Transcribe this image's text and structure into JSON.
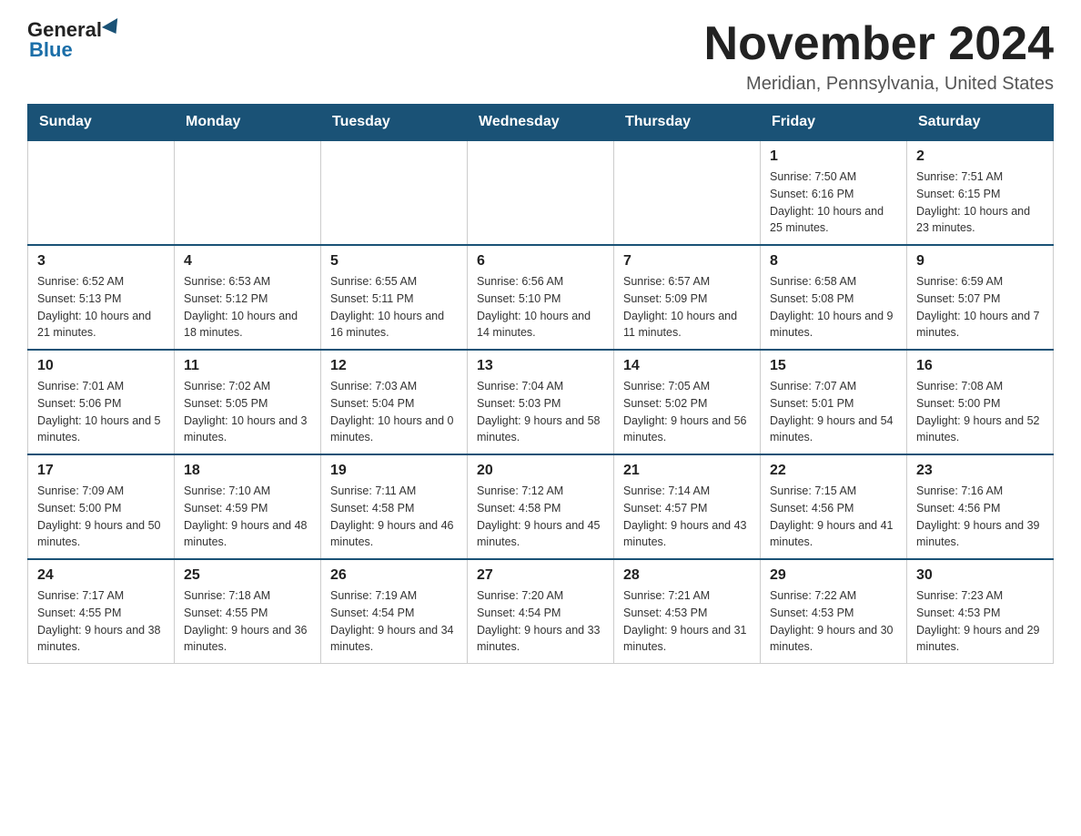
{
  "header": {
    "logo_general": "General",
    "logo_blue": "Blue",
    "month_title": "November 2024",
    "location": "Meridian, Pennsylvania, United States"
  },
  "days_of_week": [
    "Sunday",
    "Monday",
    "Tuesday",
    "Wednesday",
    "Thursday",
    "Friday",
    "Saturday"
  ],
  "weeks": [
    [
      {
        "day": "",
        "info": ""
      },
      {
        "day": "",
        "info": ""
      },
      {
        "day": "",
        "info": ""
      },
      {
        "day": "",
        "info": ""
      },
      {
        "day": "",
        "info": ""
      },
      {
        "day": "1",
        "info": "Sunrise: 7:50 AM\nSunset: 6:16 PM\nDaylight: 10 hours and 25 minutes."
      },
      {
        "day": "2",
        "info": "Sunrise: 7:51 AM\nSunset: 6:15 PM\nDaylight: 10 hours and 23 minutes."
      }
    ],
    [
      {
        "day": "3",
        "info": "Sunrise: 6:52 AM\nSunset: 5:13 PM\nDaylight: 10 hours and 21 minutes."
      },
      {
        "day": "4",
        "info": "Sunrise: 6:53 AM\nSunset: 5:12 PM\nDaylight: 10 hours and 18 minutes."
      },
      {
        "day": "5",
        "info": "Sunrise: 6:55 AM\nSunset: 5:11 PM\nDaylight: 10 hours and 16 minutes."
      },
      {
        "day": "6",
        "info": "Sunrise: 6:56 AM\nSunset: 5:10 PM\nDaylight: 10 hours and 14 minutes."
      },
      {
        "day": "7",
        "info": "Sunrise: 6:57 AM\nSunset: 5:09 PM\nDaylight: 10 hours and 11 minutes."
      },
      {
        "day": "8",
        "info": "Sunrise: 6:58 AM\nSunset: 5:08 PM\nDaylight: 10 hours and 9 minutes."
      },
      {
        "day": "9",
        "info": "Sunrise: 6:59 AM\nSunset: 5:07 PM\nDaylight: 10 hours and 7 minutes."
      }
    ],
    [
      {
        "day": "10",
        "info": "Sunrise: 7:01 AM\nSunset: 5:06 PM\nDaylight: 10 hours and 5 minutes."
      },
      {
        "day": "11",
        "info": "Sunrise: 7:02 AM\nSunset: 5:05 PM\nDaylight: 10 hours and 3 minutes."
      },
      {
        "day": "12",
        "info": "Sunrise: 7:03 AM\nSunset: 5:04 PM\nDaylight: 10 hours and 0 minutes."
      },
      {
        "day": "13",
        "info": "Sunrise: 7:04 AM\nSunset: 5:03 PM\nDaylight: 9 hours and 58 minutes."
      },
      {
        "day": "14",
        "info": "Sunrise: 7:05 AM\nSunset: 5:02 PM\nDaylight: 9 hours and 56 minutes."
      },
      {
        "day": "15",
        "info": "Sunrise: 7:07 AM\nSunset: 5:01 PM\nDaylight: 9 hours and 54 minutes."
      },
      {
        "day": "16",
        "info": "Sunrise: 7:08 AM\nSunset: 5:00 PM\nDaylight: 9 hours and 52 minutes."
      }
    ],
    [
      {
        "day": "17",
        "info": "Sunrise: 7:09 AM\nSunset: 5:00 PM\nDaylight: 9 hours and 50 minutes."
      },
      {
        "day": "18",
        "info": "Sunrise: 7:10 AM\nSunset: 4:59 PM\nDaylight: 9 hours and 48 minutes."
      },
      {
        "day": "19",
        "info": "Sunrise: 7:11 AM\nSunset: 4:58 PM\nDaylight: 9 hours and 46 minutes."
      },
      {
        "day": "20",
        "info": "Sunrise: 7:12 AM\nSunset: 4:58 PM\nDaylight: 9 hours and 45 minutes."
      },
      {
        "day": "21",
        "info": "Sunrise: 7:14 AM\nSunset: 4:57 PM\nDaylight: 9 hours and 43 minutes."
      },
      {
        "day": "22",
        "info": "Sunrise: 7:15 AM\nSunset: 4:56 PM\nDaylight: 9 hours and 41 minutes."
      },
      {
        "day": "23",
        "info": "Sunrise: 7:16 AM\nSunset: 4:56 PM\nDaylight: 9 hours and 39 minutes."
      }
    ],
    [
      {
        "day": "24",
        "info": "Sunrise: 7:17 AM\nSunset: 4:55 PM\nDaylight: 9 hours and 38 minutes."
      },
      {
        "day": "25",
        "info": "Sunrise: 7:18 AM\nSunset: 4:55 PM\nDaylight: 9 hours and 36 minutes."
      },
      {
        "day": "26",
        "info": "Sunrise: 7:19 AM\nSunset: 4:54 PM\nDaylight: 9 hours and 34 minutes."
      },
      {
        "day": "27",
        "info": "Sunrise: 7:20 AM\nSunset: 4:54 PM\nDaylight: 9 hours and 33 minutes."
      },
      {
        "day": "28",
        "info": "Sunrise: 7:21 AM\nSunset: 4:53 PM\nDaylight: 9 hours and 31 minutes."
      },
      {
        "day": "29",
        "info": "Sunrise: 7:22 AM\nSunset: 4:53 PM\nDaylight: 9 hours and 30 minutes."
      },
      {
        "day": "30",
        "info": "Sunrise: 7:23 AM\nSunset: 4:53 PM\nDaylight: 9 hours and 29 minutes."
      }
    ]
  ]
}
